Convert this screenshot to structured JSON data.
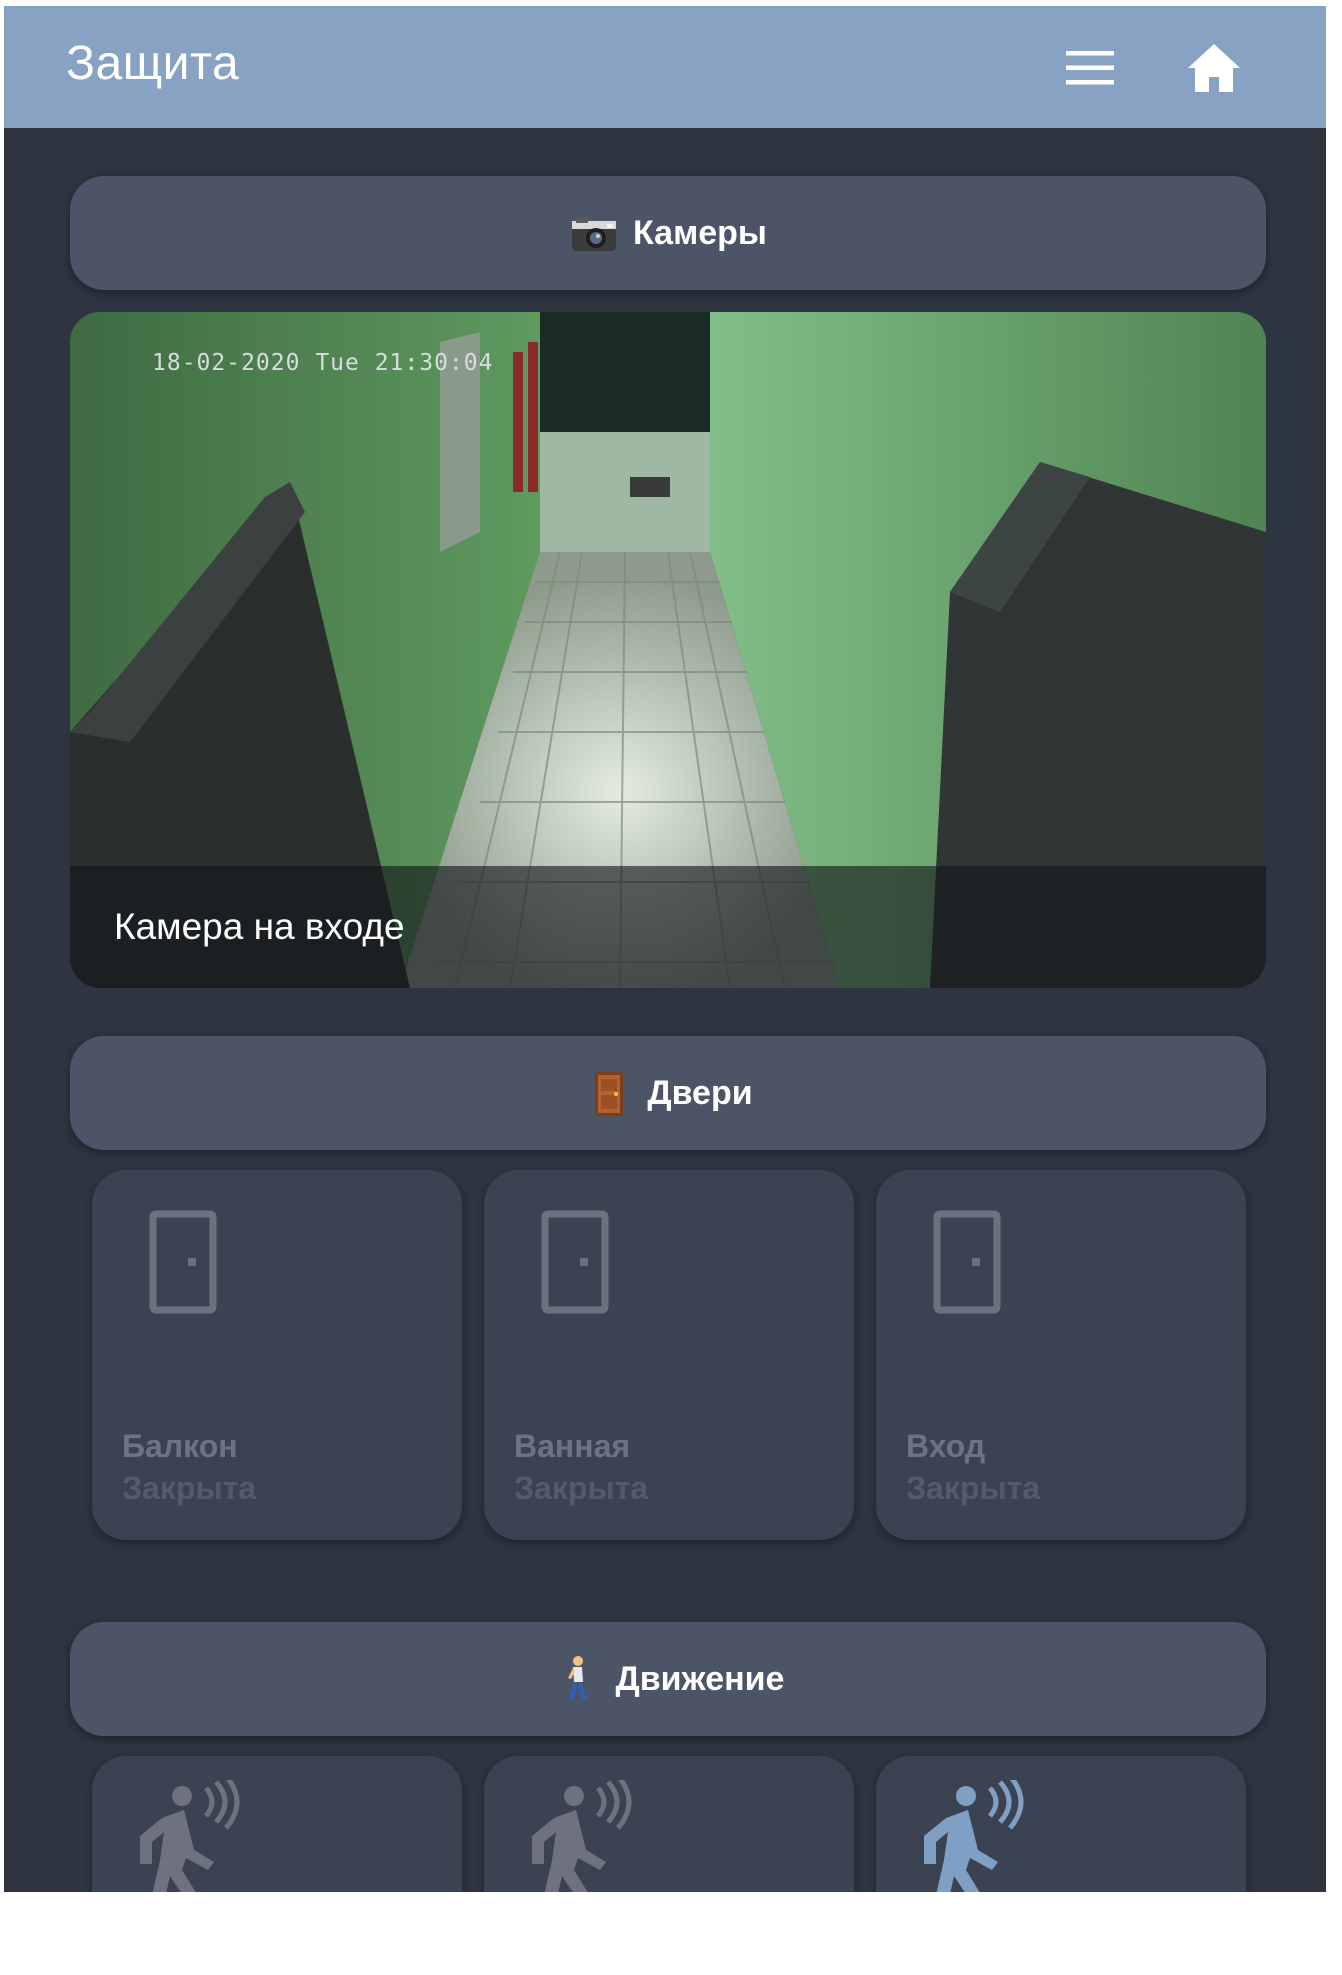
{
  "header": {
    "title": "Защита",
    "menu_icon": "hamburger-menu-icon",
    "home_icon": "home-icon"
  },
  "sections": {
    "cameras": {
      "label": "Камеры",
      "icon": "camera-emoji-icon"
    },
    "doors": {
      "label": "Двери",
      "icon": "door-emoji-icon"
    },
    "motion": {
      "label": "Движение",
      "icon": "walking-person-emoji-icon"
    }
  },
  "camera_feed": {
    "timestamp": "18-02-2020 Tue 21:30:04",
    "caption": "Камера на входе"
  },
  "doors": [
    {
      "name": "Балкон",
      "state": "Закрыта",
      "icon": "door-icon"
    },
    {
      "name": "Ванная",
      "state": "Закрыта",
      "icon": "door-icon"
    },
    {
      "name": "Вход",
      "state": "Закрыта",
      "icon": "door-icon"
    }
  ],
  "motion_sensors": [
    {
      "icon": "motion-sensor-icon",
      "active": false
    },
    {
      "icon": "motion-sensor-icon",
      "active": false
    },
    {
      "icon": "motion-sensor-icon",
      "active": true
    }
  ],
  "colors": {
    "header_bg": "#87a2c2",
    "page_bg": "#2e3440",
    "section_bg": "#4c5467",
    "tile_bg": "#3b4252",
    "inactive_icon": "#6e7280",
    "active_icon": "#7fa0c4"
  }
}
